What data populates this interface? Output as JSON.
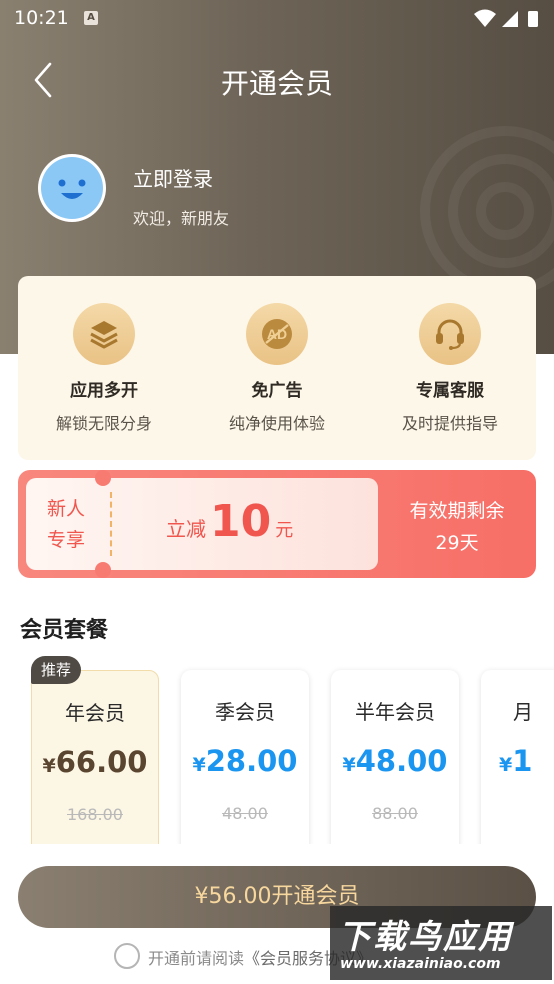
{
  "status_bar": {
    "time": "10:21",
    "notification_icon": "A"
  },
  "nav": {
    "title": "开通会员",
    "back_icon": "back-arrow-icon"
  },
  "profile": {
    "login_text": "立即登录",
    "welcome_text": "欢迎，新朋友"
  },
  "perks": [
    {
      "icon": "layers-icon",
      "title": "应用多开",
      "desc": "解锁无限分身"
    },
    {
      "icon": "ad-free-icon",
      "title": "免广告",
      "desc": "纯净使用体验"
    },
    {
      "icon": "headset-icon",
      "title": "专属客服",
      "desc": "及时提供指导"
    }
  ],
  "coupon": {
    "tag_line1": "新人",
    "tag_line2": "专享",
    "prefix": "立减",
    "amount": "10",
    "unit": "元",
    "expiry_line1": "有效期剩余",
    "expiry_line2": "29天"
  },
  "plans_section": {
    "title": "会员套餐"
  },
  "plans": [
    {
      "badge": "推荐",
      "name": "年会员",
      "currency": "¥",
      "price": "66.00",
      "original": "168.00",
      "selected": true
    },
    {
      "name": "季会员",
      "currency": "¥",
      "price": "28.00",
      "original": "48.00",
      "selected": false
    },
    {
      "name": "半年会员",
      "currency": "¥",
      "price": "48.00",
      "original": "88.00",
      "selected": false
    },
    {
      "name": "月",
      "currency": "¥",
      "price": "1",
      "original": "",
      "selected": false
    }
  ],
  "cta": {
    "label": "¥56.00开通会员"
  },
  "agreement": {
    "prefix": "开通前请阅读",
    "link": "《会员服务协议》"
  },
  "watermark": {
    "line1": "下载鸟应用",
    "line2": "www.xiazainiao.com"
  },
  "colors": {
    "gold": "#f7d79e",
    "price_blue": "#1a95f0",
    "coupon_red": "#f0564e",
    "hero_brown": "#6e6558"
  }
}
